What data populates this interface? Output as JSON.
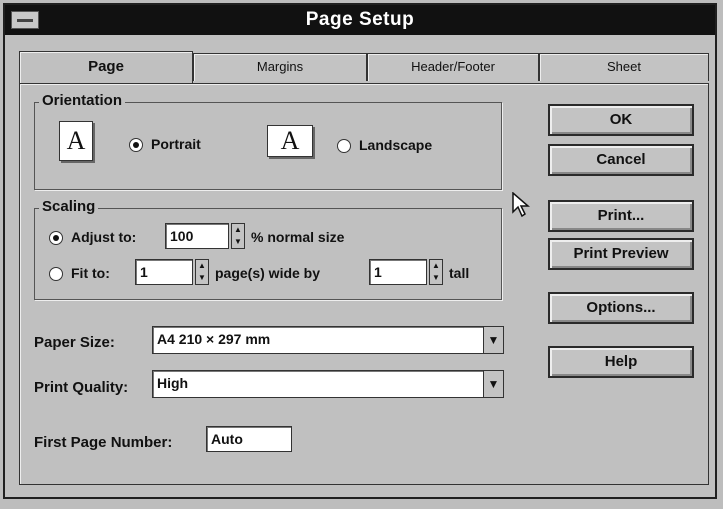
{
  "window": {
    "title": "Page Setup"
  },
  "tabs": [
    {
      "label": "Page",
      "active": true
    },
    {
      "label": "Margins",
      "active": false
    },
    {
      "label": "Header/Footer",
      "active": false
    },
    {
      "label": "Sheet",
      "active": false
    }
  ],
  "orientation": {
    "legend": "Orientation",
    "portrait_icon_glyph": "A",
    "portrait_label": "Portrait",
    "landscape_icon_glyph": "A",
    "landscape_label": "Landscape",
    "selected": "Portrait"
  },
  "scaling": {
    "legend": "Scaling",
    "adjust_label": "Adjust to:",
    "adjust_value": "100",
    "adjust_suffix": "% normal size",
    "fit_label": "Fit to:",
    "fit_wide_value": "1",
    "fit_wide_suffix": "page(s) wide by",
    "fit_tall_value": "1",
    "fit_tall_suffix": "tall",
    "selected": "Adjust to:"
  },
  "paper_size": {
    "label": "Paper Size:",
    "value": "A4 210 × 297 mm"
  },
  "print_quality": {
    "label": "Print Quality:",
    "value": "High"
  },
  "first_page_number": {
    "label": "First Page Number:",
    "value": "Auto"
  },
  "buttons": {
    "ok": "OK",
    "cancel": "Cancel",
    "print": "Print...",
    "print_preview": "Print Preview",
    "options": "Options...",
    "help": "Help"
  },
  "icons": {
    "dropdown": "down-arrow",
    "spinner": "up-down-arrows",
    "cursor": "mouse-pointer"
  }
}
